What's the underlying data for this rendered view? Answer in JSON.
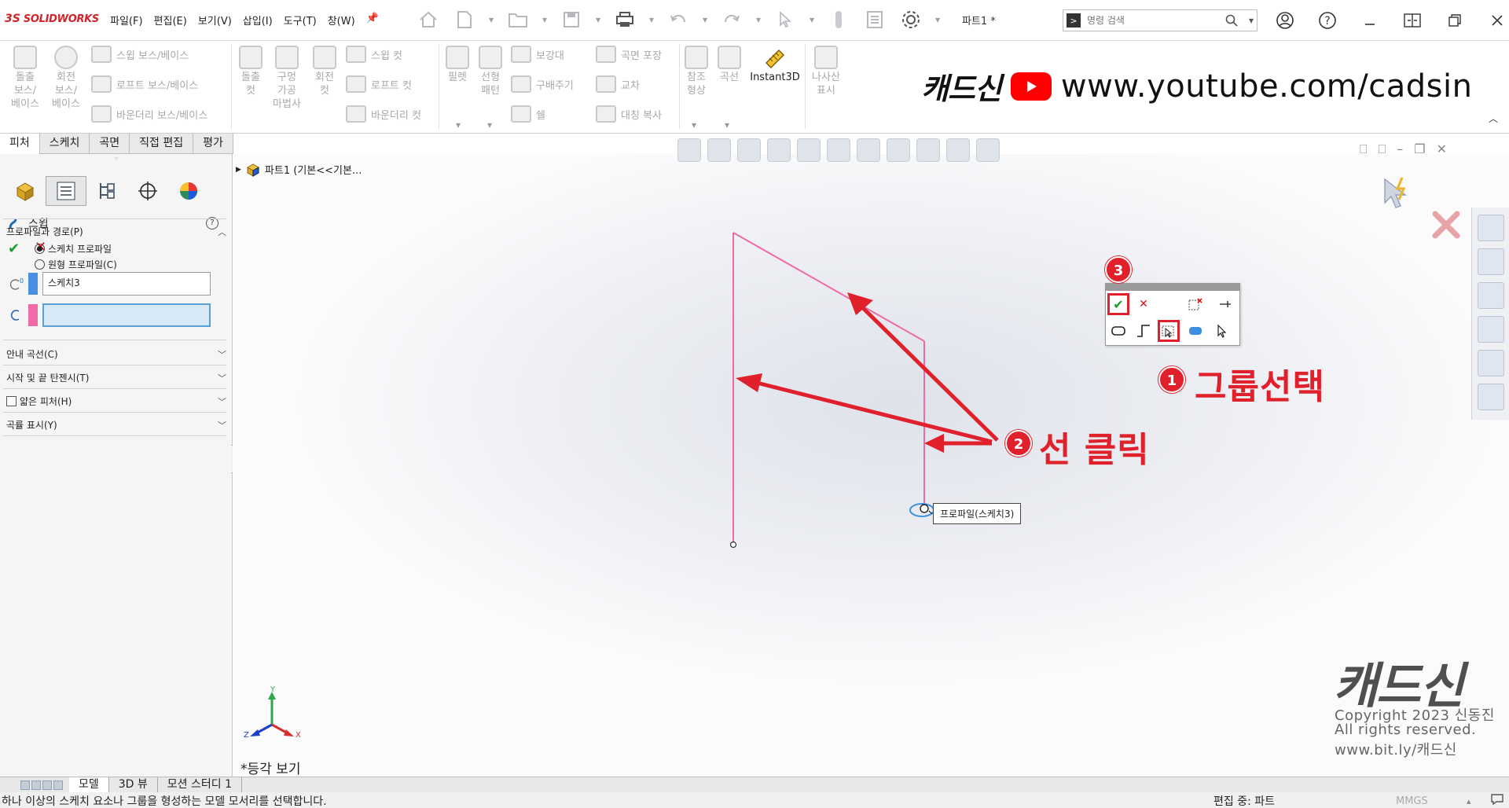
{
  "app": {
    "logo_ds": "3S",
    "logo_text": "SOLIDWORKS",
    "doc_title": "파트1 *"
  },
  "menu": [
    "파일(F)",
    "편집(E)",
    "보기(V)",
    "삽입(I)",
    "도구(T)",
    "창(W)"
  ],
  "search": {
    "placeholder": "명령 검색"
  },
  "ribbon": {
    "extrude_boss": "돌출\n보스/\n베이스",
    "revolve_boss": "회전\n보스/\n베이스",
    "sweep_boss": "스윕 보스/베이스",
    "loft_boss": "로프트 보스/베이스",
    "boundary_boss": "바운더리 보스/베이스",
    "extrude_cut": "돌출\n컷",
    "hole_wizard": "구멍\n가공\n마법사",
    "revolve_cut": "회전\n컷",
    "sweep_cut": "스윕 컷",
    "loft_cut": "로프트 컷",
    "boundary_cut": "바운더리 컷",
    "fillet": "필렛",
    "linear_pattern": "선형\n패턴",
    "rib": "보강대",
    "draft": "구배주기",
    "shell": "쉘",
    "wrap": "곡면 포장",
    "intersect": "교차",
    "mirror": "대칭 복사",
    "ref_geometry": "참조\n형상",
    "curves": "곡선",
    "instant3d": "Instant3D",
    "helix": "나사산\n표시"
  },
  "banner": {
    "brand": "캐드신",
    "url": "www.youtube.com/cadsin"
  },
  "command_tabs": [
    "피처",
    "스케치",
    "곡면",
    "직접 편집",
    "평가"
  ],
  "property_manager": {
    "title": "스윕",
    "help": "?",
    "sections": {
      "profile_path": "프로파일과 경로(P)",
      "guide_curves": "안내 곡선(C)",
      "tangency": "시작 및 끝 탄젠시(T)",
      "thin_feature": "얇은 피처(H)",
      "curvature_display": "곡률 표시(Y)"
    },
    "radio_sketch_profile": "스케치 프로파일",
    "radio_circular_profile": "원형 프로파일(C)",
    "profile_value": "스케치3",
    "path_value": "",
    "colors": {
      "profile_swatch": "#4a90e2",
      "path_swatch": "#ef6aa6"
    }
  },
  "tree": {
    "root": "파트1  (기본<<기본..."
  },
  "popup": {
    "ok": "✔",
    "cancel": "✕"
  },
  "tooltip": "프로파일(스케치3)",
  "annotations": {
    "badge1": "1",
    "badge2": "2",
    "badge3": "3",
    "label1": "그룹선택",
    "label2": "선 클릭"
  },
  "watermark": {
    "brand": "캐드신",
    "line1": "Copyright 2023 신동진",
    "line2": "All rights reserved.",
    "line3": "www.bit.ly/캐드신"
  },
  "view_label": "*등각 보기",
  "triad": {
    "y": "Y",
    "x": "X",
    "z": "Z"
  },
  "bottom_tabs": [
    "모델",
    "3D 뷰",
    "모션 스터디 1"
  ],
  "status": {
    "message": "하나 이상의 스케치 요소나 그룹을 형성하는 모델 모서리를 선택합니다.",
    "editing": "편집 중: 파트",
    "units": "MMGS"
  },
  "colors": {
    "accent_red": "#e0202a",
    "sketch_pink": "#ef6aa6",
    "ok_green": "#1a9c2c"
  }
}
